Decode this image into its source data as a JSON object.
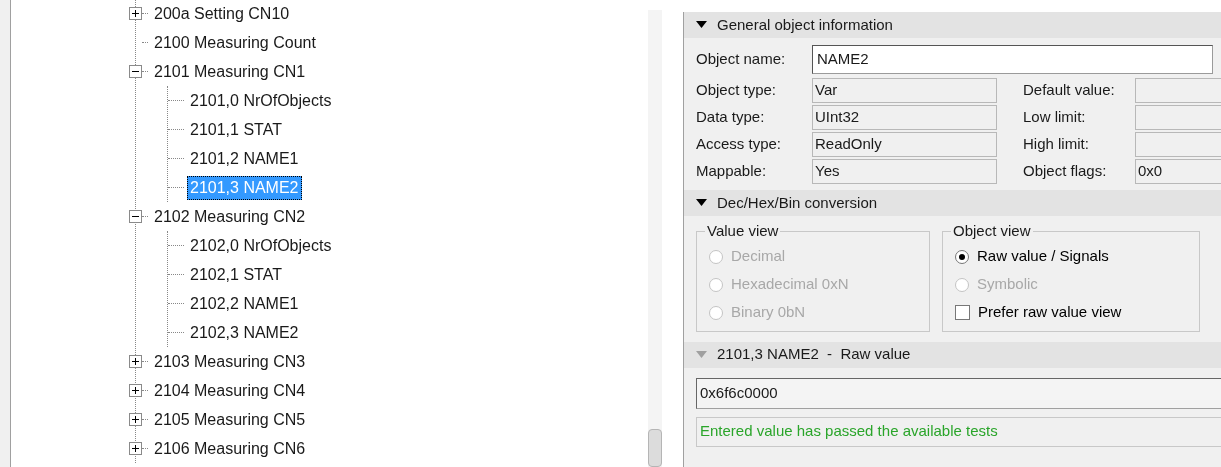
{
  "tree": {
    "items": [
      {
        "label": "200a Setting CN10",
        "expanded": false,
        "selected": false
      },
      {
        "label": "2100 Measuring Count",
        "selected": false
      },
      {
        "label": "2101 Measuring CN1",
        "expanded": true,
        "selected": false,
        "children": [
          {
            "label": "2101,0 NrOfObjects",
            "selected": false
          },
          {
            "label": "2101,1 STAT",
            "selected": false
          },
          {
            "label": "2101,2 NAME1",
            "selected": false
          },
          {
            "label": "2101,3 NAME2",
            "selected": true
          }
        ]
      },
      {
        "label": "2102 Measuring CN2",
        "expanded": true,
        "selected": false,
        "children": [
          {
            "label": "2102,0 NrOfObjects",
            "selected": false
          },
          {
            "label": "2102,1 STAT",
            "selected": false
          },
          {
            "label": "2102,2 NAME1",
            "selected": false
          },
          {
            "label": "2102,3 NAME2",
            "selected": false
          }
        ]
      },
      {
        "label": "2103 Measuring CN3",
        "expanded": false,
        "selected": false
      },
      {
        "label": "2104 Measuring CN4",
        "expanded": false,
        "selected": false
      },
      {
        "label": "2105 Measuring CN5",
        "expanded": false,
        "selected": false
      },
      {
        "label": "2106 Measuring CN6",
        "expanded": false,
        "selected": false
      }
    ]
  },
  "general": {
    "title": "General object information",
    "expanded": true,
    "name_label": "Object name:",
    "name_value": "NAME2",
    "left_fields": [
      {
        "label": "Object type:",
        "value": "Var"
      },
      {
        "label": "Data type:",
        "value": "UInt32"
      },
      {
        "label": "Access type:",
        "value": "ReadOnly"
      },
      {
        "label": "Mappable:",
        "value": "Yes"
      }
    ],
    "right_fields": [
      {
        "label": "Default value:"
      },
      {
        "label": "Low limit:"
      },
      {
        "label": "High limit:"
      },
      {
        "label": "Object flags:",
        "value": "0x0"
      }
    ]
  },
  "conversion": {
    "title": "Dec/Hex/Bin conversion",
    "expanded": true,
    "value_view": {
      "title": "Value view",
      "options": [
        {
          "kind": "radio",
          "label": "Decimal",
          "selected": false,
          "disabled": true
        },
        {
          "kind": "radio",
          "label": "Hexadecimal 0xN",
          "selected": false,
          "disabled": true
        },
        {
          "kind": "radio",
          "label": "Binary 0bN",
          "selected": false,
          "disabled": true
        }
      ]
    },
    "object_view": {
      "title": "Object view",
      "options": [
        {
          "kind": "radio",
          "label": "Raw value / Signals",
          "selected": true,
          "disabled": false
        },
        {
          "kind": "radio",
          "label": "Symbolic",
          "selected": false,
          "disabled": true
        },
        {
          "kind": "checkbox",
          "label": "Prefer raw value view",
          "checked": false,
          "disabled": false
        }
      ]
    }
  },
  "raw": {
    "title": "2101,3 NAME2  -  Raw value",
    "expanded": true,
    "disabled": true,
    "value": "0x6f6c0000",
    "message": "Entered value has passed the available tests"
  }
}
